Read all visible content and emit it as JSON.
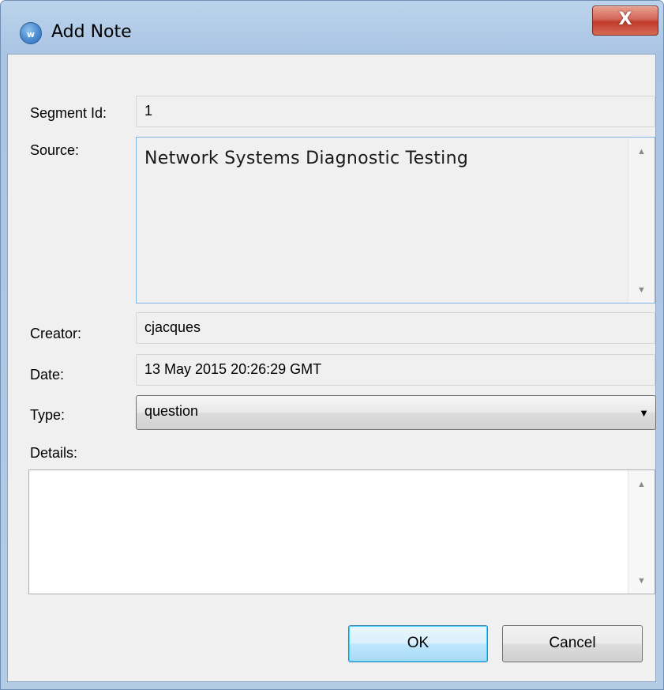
{
  "window": {
    "title": "Add Note",
    "close_label": "X",
    "app_icon": "wordfast-logo-icon"
  },
  "form": {
    "segment_id": {
      "label": "Segment Id:",
      "value": "1"
    },
    "source": {
      "label": "Source:",
      "value": "Network Systems Diagnostic Testing"
    },
    "creator": {
      "label": "Creator:",
      "value": "cjacques"
    },
    "date": {
      "label": "Date:",
      "value": "13 May 2015 20:26:29 GMT"
    },
    "type": {
      "label": "Type:",
      "selected": "question"
    },
    "details": {
      "label": "Details:",
      "value": ""
    }
  },
  "buttons": {
    "ok_label": "OK",
    "cancel_label": "Cancel"
  },
  "colors": {
    "titlebar": "#bcd3ec",
    "client_bg": "#f0f0f0",
    "close_button": "#c03a2b",
    "default_button_border": "#3c7fb1"
  }
}
